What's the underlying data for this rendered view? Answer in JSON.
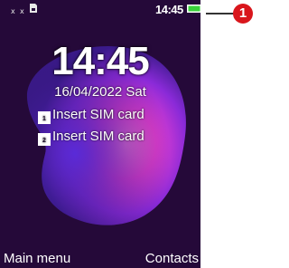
{
  "status_bar": {
    "signal_1": "x",
    "signal_2": "x",
    "sim_icon": "sim-card-icon",
    "time": "14:45",
    "battery_icon": "battery-full-icon",
    "battery_color": "#39d13a"
  },
  "lock_screen": {
    "clock": "14:45",
    "date": "16/04/2022 Sat",
    "sims": [
      {
        "badge": "1",
        "text": "Insert SIM card"
      },
      {
        "badge": "2",
        "text": "Insert SIM card"
      }
    ]
  },
  "softkeys": {
    "left": "Main menu",
    "right": "Contacts"
  },
  "callout": {
    "number": "1",
    "color": "#d9161c"
  }
}
